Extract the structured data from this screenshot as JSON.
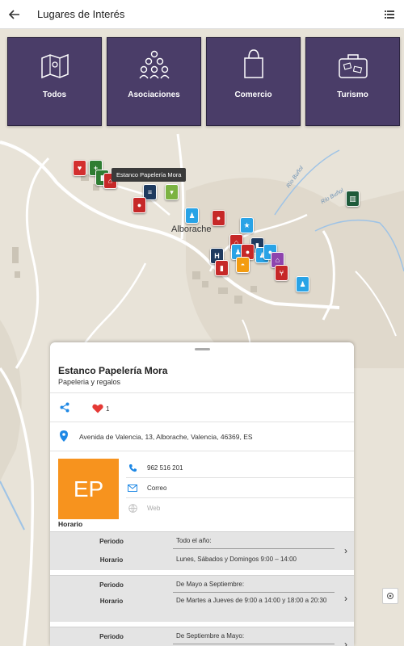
{
  "appbar": {
    "title": "Lugares de Interés",
    "back_icon": "arrow-left-icon",
    "list_icon": "list-view-icon"
  },
  "categories": [
    {
      "label": "Todos",
      "icon": "map-icon"
    },
    {
      "label": "Asociaciones",
      "icon": "people-group-icon"
    },
    {
      "label": "Comercio",
      "icon": "shopping-bag-icon"
    },
    {
      "label": "Turismo",
      "icon": "suitcase-icon"
    }
  ],
  "map": {
    "tooltip": "Estanco Papelería Mora",
    "town": "Alborache",
    "river1": "Río Buñol",
    "river2": "Río Buñol",
    "tile_color": "#4a3d68"
  },
  "sheet": {
    "title": "Estanco Papelería Mora",
    "subtitle": "Papeleria y regalos",
    "likes": "1",
    "address": "Avenida de Valencia, 13, Alborache, Valencia, 46369, ES",
    "logo_text": "EP",
    "logo_color": "#f7931e",
    "phone": "962 516 201",
    "email_label": "Correo",
    "web_label": "Web",
    "horario_label": "Horario",
    "schedule": [
      {
        "periodo_key": "Periodo",
        "periodo": "Todo el año:",
        "horario_key": "Horario",
        "horario": "Lunes, Sábados y Domingos 9:00 – 14:00"
      },
      {
        "periodo_key": "Periodo",
        "periodo": "De Mayo a Septiembre:",
        "horario_key": "Horario",
        "horario": "De Martes a Jueves de 9:00 a 14:00 y 18:00 a 20:30"
      },
      {
        "periodo_key": "Periodo",
        "periodo": "De Septiembre a Mayo:",
        "horario_key": "Horario",
        "horario": ""
      }
    ]
  }
}
